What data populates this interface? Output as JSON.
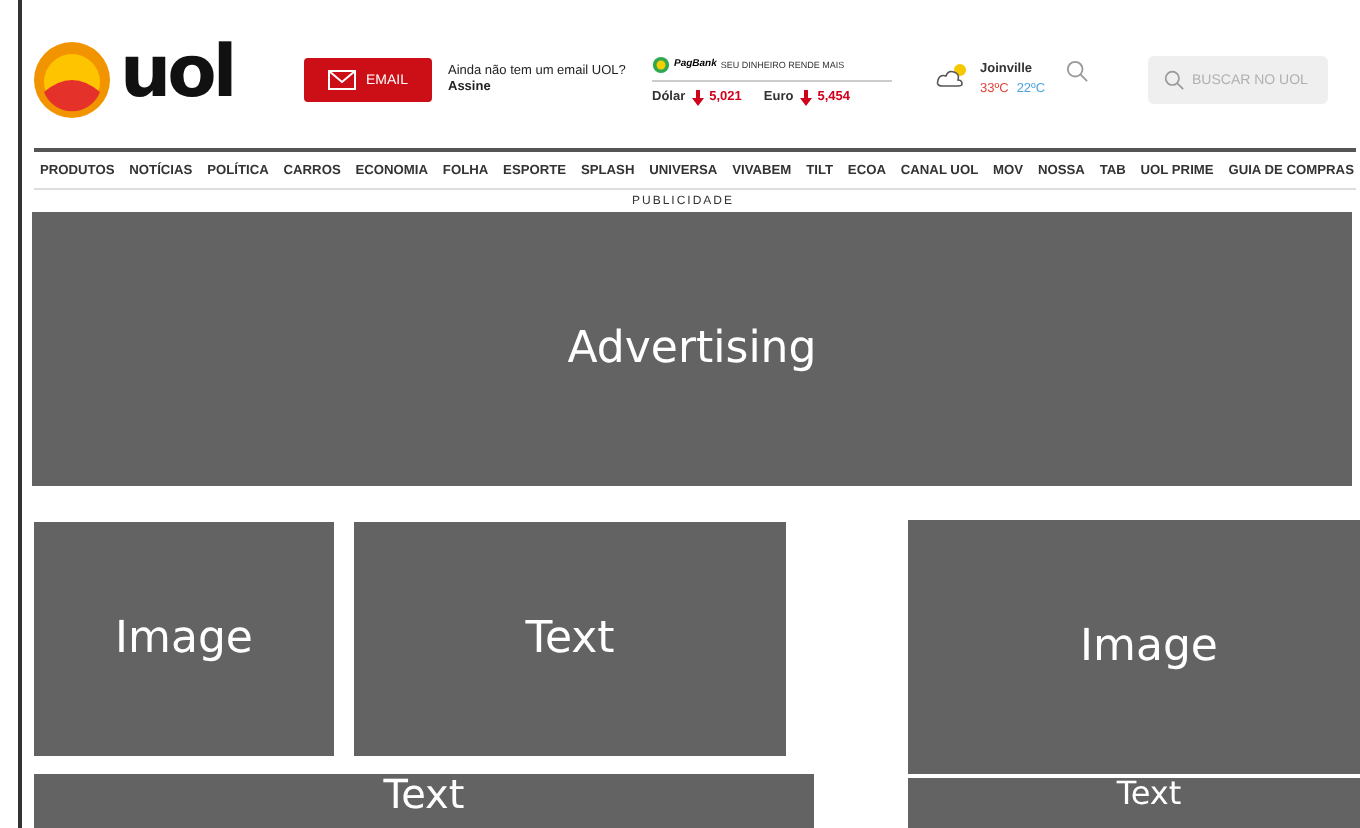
{
  "header": {
    "logo": "uol",
    "email_button": "EMAIL",
    "signup_text": "Ainda não tem um email UOL? **Assine**",
    "finance": {
      "brand": "PagBank",
      "slogan": "SEU DINHEIRO RENDE MAIS",
      "quotes": [
        {
          "label": "Dólar",
          "value": "5,021",
          "kind": "down"
        },
        {
          "label": "Euro",
          "value": "5,454",
          "kind": "down"
        }
      ]
    },
    "weather": {
      "city": "Joinville",
      "max": "33ºC",
      "min": "22ºC"
    },
    "search": {
      "placeholder": "BUSCAR NO UOL"
    }
  },
  "nav": [
    "PRODUTOS",
    "NOTÍCIAS",
    "POLÍTICA",
    "CARROS",
    "ECONOMIA",
    "FOLHA",
    "ESPORTE",
    "SPLASH",
    "UNIVERSA",
    "VIVABEM",
    "TILT",
    "ECOA",
    "CANAL UOL",
    "MOV",
    "NOSSA",
    "TAB",
    "UOL PRIME",
    "GUIA DE COMPRAS"
  ],
  "ad": {
    "label": "PUBLICIDADE",
    "placeholder": "Advertising"
  },
  "blocks": [
    "Image",
    "Text",
    "Text",
    "Image",
    "Text"
  ]
}
